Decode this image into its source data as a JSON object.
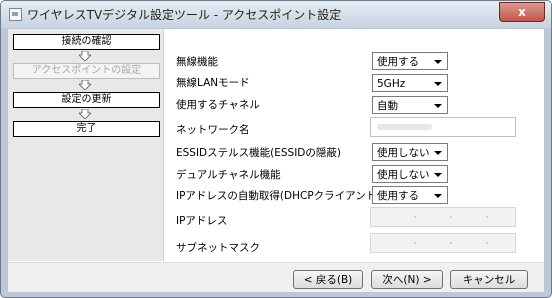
{
  "window": {
    "title": "ワイヤレスTVデジタル設定ツール - アクセスポイント設定",
    "close_label": "x"
  },
  "steps": [
    {
      "label": "接続の確認",
      "state": "done"
    },
    {
      "label": "アクセスポイントの設定",
      "state": "current"
    },
    {
      "label": "設定の更新",
      "state": "pending"
    },
    {
      "label": "完了",
      "state": "pending"
    }
  ],
  "form": {
    "wireless_function": {
      "label": "無線機能",
      "value": "使用する"
    },
    "wireless_lan_mode": {
      "label": "無線LANモード",
      "value": "5GHz"
    },
    "channel": {
      "label": "使用するチャネル",
      "value": "自動"
    },
    "network_name": {
      "label": "ネットワーク名",
      "value": ""
    },
    "essid_stealth": {
      "label": "ESSIDステルス機能(ESSIDの隠蔽)",
      "value": "使用しない"
    },
    "dual_channel": {
      "label": "デュアルチャネル機能",
      "value": "使用しない"
    },
    "ip_auto": {
      "label": "IPアドレスの自動取得(DHCPクライアント)",
      "value": "使用する"
    },
    "ip_address": {
      "label": "IPアドレス",
      "value": ""
    },
    "subnet_mask": {
      "label": "サブネットマスク",
      "value": ""
    }
  },
  "buttons": {
    "back": "< 戻る(B)",
    "next": "次へ(N) >",
    "cancel": "キャンセル"
  },
  "colors": {
    "frame": "#bcc8d6",
    "close_button": "#c2564a"
  }
}
